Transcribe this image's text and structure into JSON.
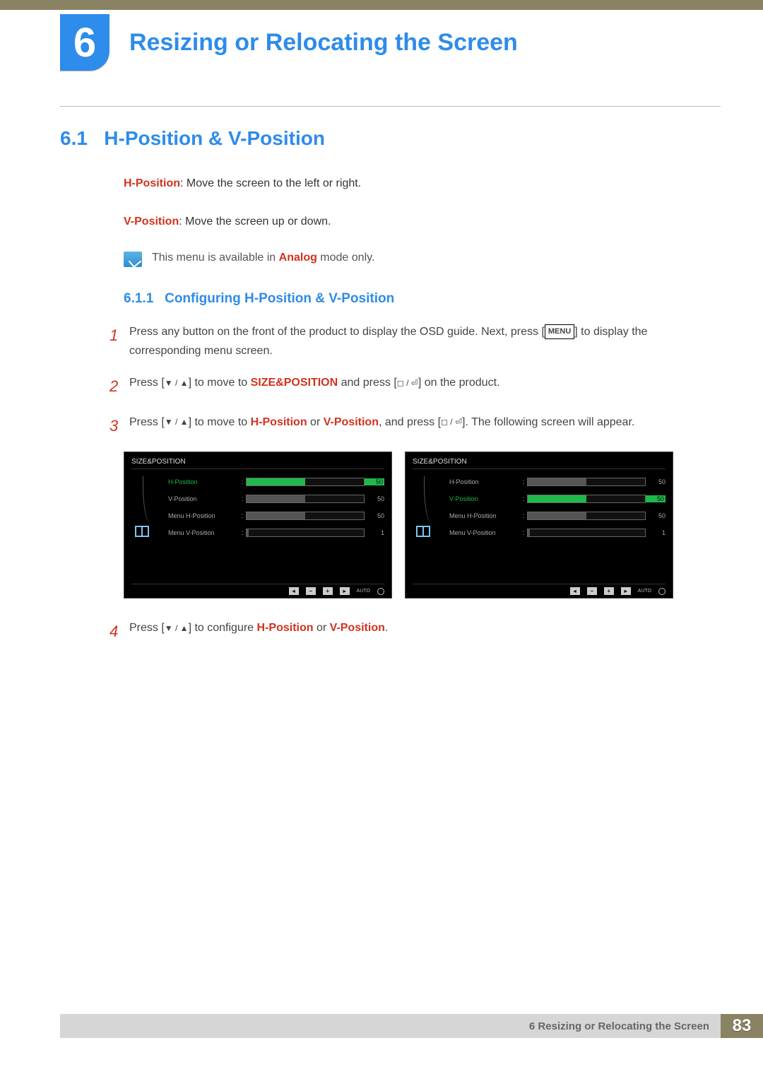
{
  "chapter": {
    "number": "6",
    "title": "Resizing or Relocating the Screen"
  },
  "section": {
    "number": "6.1",
    "title": "H-Position & V-Position"
  },
  "definitions": {
    "h_position_term": "H-Position",
    "h_position_desc": ": Move the screen to the left or right.",
    "v_position_term": "V-Position",
    "v_position_desc": ": Move the screen up or down."
  },
  "note": {
    "prefix": "This menu is available in ",
    "mode": "Analog",
    "suffix": " mode only."
  },
  "subsection": {
    "number": "6.1.1",
    "title": "Configuring H-Position & V-Position"
  },
  "steps": {
    "s1_num": "1",
    "s1_a": "Press any button on the front of the product to display the OSD guide. Next, press [",
    "s1_key": "MENU",
    "s1_b": "] to display the corresponding menu screen.",
    "s2_num": "2",
    "s2_a": "Press [",
    "s2_b": "] to move to ",
    "s2_target": "SIZE&POSITION",
    "s2_c": " and press [",
    "s2_d": "] on the product.",
    "s3_num": "3",
    "s3_a": "Press [",
    "s3_b": "] to move to ",
    "s3_h": "H-Position",
    "s3_or": " or ",
    "s3_v": "V-Position",
    "s3_c": ", and press [",
    "s3_d": "]. The following screen will appear.",
    "s4_num": "4",
    "s4_a": "Press [",
    "s4_b": "] to configure ",
    "s4_h": "H-Position",
    "s4_or": " or ",
    "s4_v": "V-Position",
    "s4_c": "."
  },
  "osd_left": {
    "title": "SIZE&POSITION",
    "rows": [
      {
        "label": "H-Position",
        "active": true,
        "fill": 50,
        "green": true,
        "val": "50",
        "valGreen": true
      },
      {
        "label": "V-Position",
        "active": false,
        "fill": 50,
        "green": false,
        "val": "50",
        "valGreen": false
      },
      {
        "label": "Menu H-Position",
        "active": false,
        "fill": 50,
        "green": false,
        "val": "50",
        "valGreen": false
      },
      {
        "label": "Menu V-Position",
        "active": false,
        "fill": 2,
        "green": false,
        "val": "1",
        "valGreen": false
      }
    ],
    "auto": "AUTO"
  },
  "osd_right": {
    "title": "SIZE&POSITION",
    "rows": [
      {
        "label": "H-Position",
        "active": false,
        "fill": 50,
        "green": false,
        "val": "50",
        "valGreen": false
      },
      {
        "label": "V-Position",
        "active": true,
        "fill": 50,
        "green": true,
        "val": "50",
        "valGreen": true
      },
      {
        "label": "Menu H-Position",
        "active": false,
        "fill": 50,
        "green": false,
        "val": "50",
        "valGreen": false
      },
      {
        "label": "Menu V-Position",
        "active": false,
        "fill": 2,
        "green": false,
        "val": "1",
        "valGreen": false
      }
    ],
    "auto": "AUTO"
  },
  "footer": {
    "label": "6 Resizing or Relocating the Screen",
    "page": "83"
  }
}
